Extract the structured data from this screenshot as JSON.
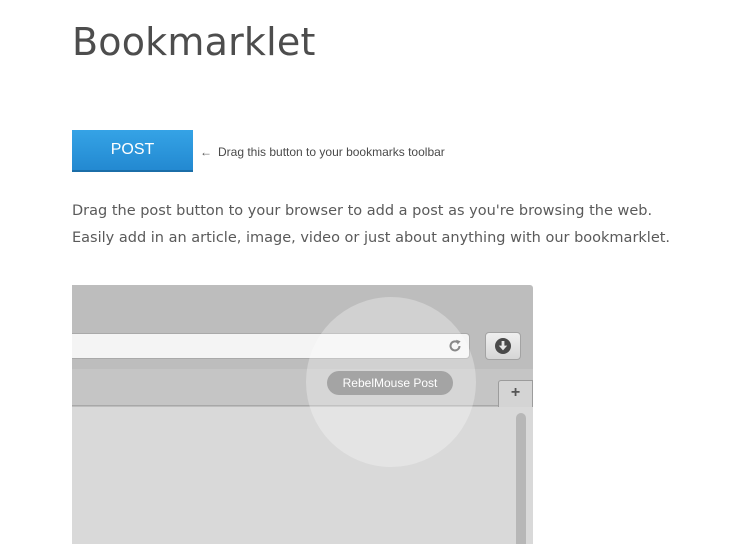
{
  "page": {
    "title": "Bookmarklet"
  },
  "post_button": {
    "label": "POST",
    "color": "#2a94dc"
  },
  "hint": {
    "arrow": "←",
    "text": "Drag this button to your bookmarks toolbar"
  },
  "description": {
    "line1": "Drag the post button to your browser to add a post as you're browsing the web.",
    "line2": "Easily add in an article, image, video or just about anything with our bookmarklet."
  },
  "illustration": {
    "bookmark_label": "RebelMouse Post",
    "new_tab_label": "+",
    "icons": [
      "reload-icon",
      "download-icon",
      "plus-icon"
    ]
  }
}
